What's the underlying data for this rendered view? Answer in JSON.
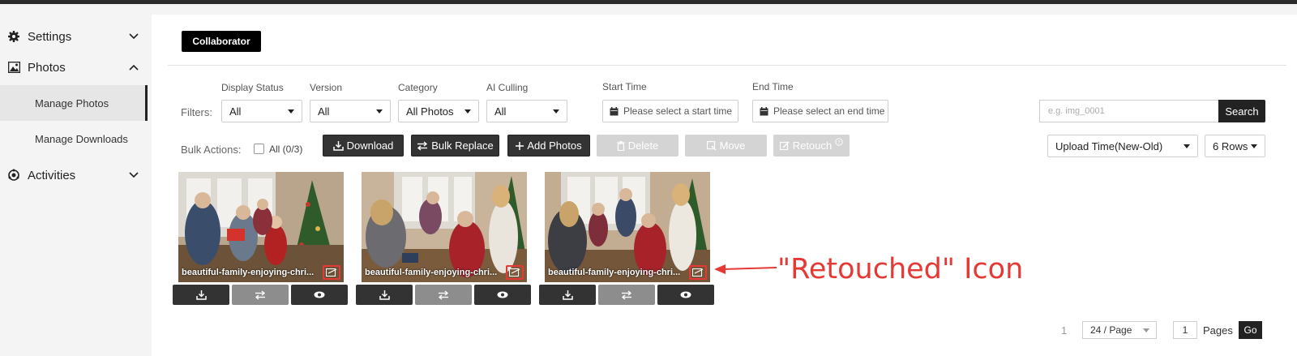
{
  "sidebar": {
    "settings": "Settings",
    "photos": "Photos",
    "manage_photos": "Manage Photos",
    "manage_downloads": "Manage Downloads",
    "activities": "Activities"
  },
  "header": {
    "collaborator": "Collaborator"
  },
  "filters": {
    "label": "Filters:",
    "display_status": {
      "label": "Display Status",
      "value": "All"
    },
    "version": {
      "label": "Version",
      "value": "All"
    },
    "category": {
      "label": "Category",
      "value": "All Photos"
    },
    "ai_culling": {
      "label": "AI Culling",
      "value": "All"
    },
    "start_time": {
      "label": "Start Time",
      "placeholder": "Please select a start time"
    },
    "end_time": {
      "label": "End Time",
      "placeholder": "Please select an end time"
    },
    "search": {
      "placeholder": "e.g. img_0001",
      "button": "Search"
    }
  },
  "bulk": {
    "label": "Bulk Actions:",
    "all": "All (0/3)",
    "download": "Download",
    "bulk_replace": "Bulk Replace",
    "add_photos": "Add Photos",
    "delete": "Delete",
    "move": "Move",
    "retouch": "Retouch",
    "sort": "Upload Time(New-Old)",
    "rows": "6 Rows"
  },
  "photos": [
    {
      "caption": "beautiful-family-enjoying-chri..."
    },
    {
      "caption": "beautiful-family-enjoying-chri..."
    },
    {
      "caption": "beautiful-family-enjoying-chri..."
    }
  ],
  "annotation": "\"Retouched\" Icon",
  "pagination": {
    "page": "1",
    "per_page": "24 / Page",
    "goto_value": "1",
    "pages_label": "Pages",
    "go": "Go"
  },
  "colors": {
    "accent": "#e53935",
    "dark": "#333333"
  }
}
